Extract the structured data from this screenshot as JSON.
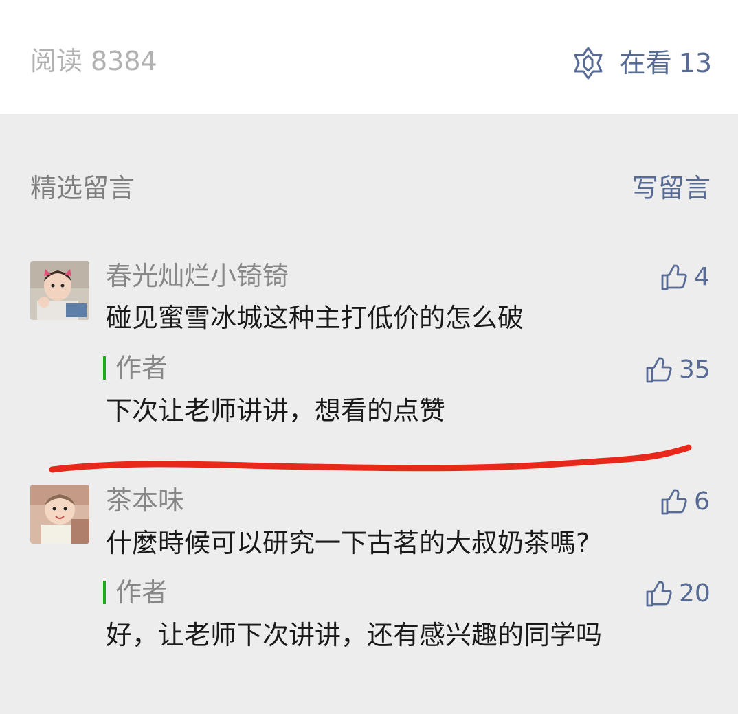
{
  "header": {
    "read_label": "阅读",
    "read_count": "8384",
    "watching_label": "在看",
    "watching_count": "13",
    "watching_icon": "wow-star-icon"
  },
  "comments_section": {
    "title": "精选留言",
    "write_label": "写留言"
  },
  "comments": [
    {
      "nickname": "春光灿烂小锜锜",
      "text": "碰见蜜雪冰城这种主打低价的怎么破",
      "likes": "4",
      "reply": {
        "author_label": "作者",
        "text": "下次让老师讲讲，想看的点赞",
        "likes": "35"
      }
    },
    {
      "nickname": "茶本味",
      "text": "什麼時候可以研究一下古茗的大叔奶茶嗎?",
      "likes": "6",
      "reply": {
        "author_label": "作者",
        "text": "好，让老师下次讲讲，还有感兴趣的同学吗",
        "likes": "20"
      }
    }
  ],
  "colors": {
    "link_blue": "#576b95",
    "author_green": "#1aad19",
    "annotation_red": "#e8281a",
    "background": "#ededed"
  }
}
